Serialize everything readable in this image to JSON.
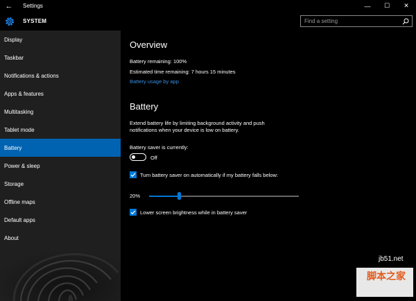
{
  "window": {
    "title": "Settings",
    "back_glyph": "←",
    "minimize_glyph": "—",
    "maximize_glyph": "☐",
    "close_glyph": "✕"
  },
  "header": {
    "section_title": "SYSTEM",
    "search_placeholder": "Find a setting"
  },
  "sidebar": {
    "items": [
      {
        "label": "Display"
      },
      {
        "label": "Taskbar"
      },
      {
        "label": "Notifications & actions"
      },
      {
        "label": "Apps & features"
      },
      {
        "label": "Multitasking"
      },
      {
        "label": "Tablet mode"
      },
      {
        "label": "Battery",
        "active": true
      },
      {
        "label": "Power & sleep"
      },
      {
        "label": "Storage"
      },
      {
        "label": "Offline maps"
      },
      {
        "label": "Default apps"
      },
      {
        "label": "About"
      }
    ]
  },
  "overview": {
    "heading": "Overview",
    "battery_remaining": "Battery remaining: 100%",
    "time_remaining": "Estimated time remaining: 7 hours 15 minutes",
    "usage_link": "Battery usage by app"
  },
  "battery": {
    "heading": "Battery",
    "description_line1": "Extend battery life by limiting background activity and push",
    "description_line2": "notifications when your device is low on battery.",
    "saver_label": "Battery saver is currently:",
    "saver_state": "Off",
    "auto_on_label": "Turn battery saver on automatically if my battery falls below:",
    "auto_on_checked": true,
    "threshold_label": "20%",
    "threshold_value": 0.2,
    "lower_brightness_label": "Lower screen brightness while in battery saver",
    "lower_brightness_checked": true
  },
  "watermark": {
    "url": "jb51.net",
    "text": "脚本之家"
  },
  "colors": {
    "accent": "#0078d7",
    "sidebar_active": "#0063b1",
    "link": "#3a8ede"
  }
}
